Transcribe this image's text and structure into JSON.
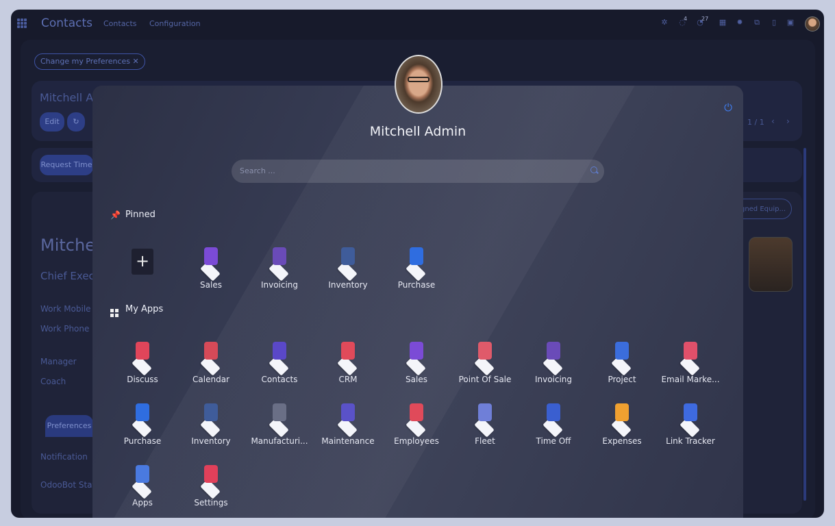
{
  "navbar": {
    "brand": "Contacts",
    "links": [
      "Contacts",
      "Configuration"
    ],
    "activity_count": "4",
    "messages_count": "27"
  },
  "background": {
    "pref_pill": "Change my Preferences",
    "record_title": "Mitchell Ad",
    "edit_label": "Edit",
    "pager": "1 / 1",
    "request_time": "Request Time",
    "name_big": "Mitchel",
    "job": "Chief Execu",
    "fields": [
      "Work Mobile",
      "Work Phone",
      "Manager",
      "Coach"
    ],
    "tab": "Preferences",
    "bottom_fields": [
      "Notification",
      "OdooBot Statu"
    ],
    "equipment_btn": "gned Equip..."
  },
  "menu": {
    "user_name": "Mitchell Admin",
    "search_placeholder": "Search ...",
    "pinned_title": "Pinned",
    "myapps_title": "My Apps",
    "pinned": [
      {
        "label": "Sales",
        "color": "#7b4bd6"
      },
      {
        "label": "Invoicing",
        "color": "#6a4bb8"
      },
      {
        "label": "Inventory",
        "color": "#3f5c9a"
      },
      {
        "label": "Purchase",
        "color": "#2f6de0"
      }
    ],
    "apps": [
      {
        "label": "Discuss",
        "color": "#e0455a"
      },
      {
        "label": "Calendar",
        "color": "#d64a58"
      },
      {
        "label": "Contacts",
        "color": "#5a48c8"
      },
      {
        "label": "CRM",
        "color": "#e04a5a"
      },
      {
        "label": "Sales",
        "color": "#7b4bd6"
      },
      {
        "label": "Point Of Sale",
        "color": "#e05a6a"
      },
      {
        "label": "Invoicing",
        "color": "#6a4bb8"
      },
      {
        "label": "Project",
        "color": "#3b6ddc"
      },
      {
        "label": "Email Marke...",
        "color": "#e0506a"
      },
      {
        "label": "Purchase",
        "color": "#2f6de0"
      },
      {
        "label": "Inventory",
        "color": "#3f5c9a"
      },
      {
        "label": "Manufacturi...",
        "color": "#6a6f86"
      },
      {
        "label": "Maintenance",
        "color": "#5a52c8"
      },
      {
        "label": "Employees",
        "color": "#e04a5a"
      },
      {
        "label": "Fleet",
        "color": "#6f7fd8"
      },
      {
        "label": "Time Off",
        "color": "#3a5fd0"
      },
      {
        "label": "Expenses",
        "color": "#f0a030"
      },
      {
        "label": "Link Tracker",
        "color": "#3e6ae0"
      },
      {
        "label": "Apps",
        "color": "#4a7ae0"
      },
      {
        "label": "Settings",
        "color": "#e0405a"
      }
    ]
  }
}
